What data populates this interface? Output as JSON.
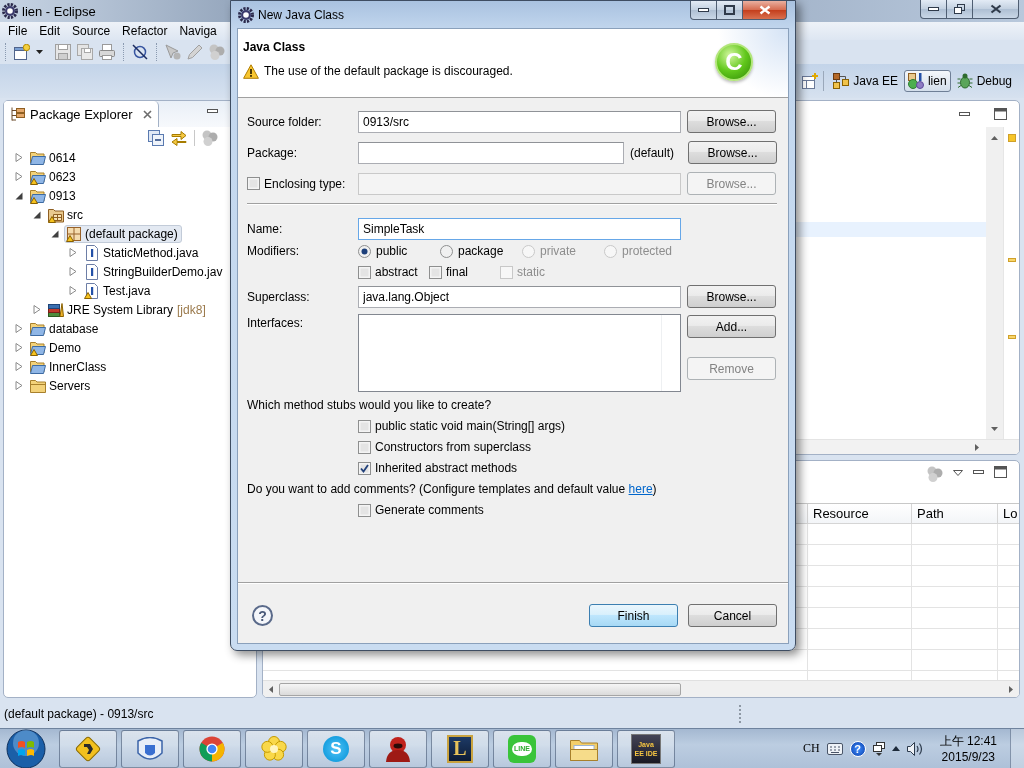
{
  "eclipse_window": {
    "title": "lien - Eclipse"
  },
  "menu_bar": [
    "File",
    "Edit",
    "Source",
    "Refactor",
    "Naviga"
  ],
  "perspectives": [
    {
      "label": "Java EE",
      "kind": "enterprise",
      "selected": false
    },
    {
      "label": "lien",
      "kind": "java",
      "selected": true
    },
    {
      "label": "Debug",
      "kind": "debug",
      "selected": false
    }
  ],
  "package_explorer": {
    "title": "Package Explorer",
    "tree": [
      {
        "label": "0614",
        "kind": "project",
        "warning": false,
        "expanded": false,
        "selected": false
      },
      {
        "label": "0623",
        "kind": "project",
        "warning": true,
        "expanded": false,
        "selected": false
      },
      {
        "label": "0913",
        "kind": "project",
        "warning": true,
        "expanded": true,
        "selected": false,
        "children": [
          {
            "label": "src",
            "kind": "source_folder",
            "warning": true,
            "expanded": true,
            "selected": false,
            "children": [
              {
                "label": "(default package)",
                "kind": "package",
                "warning": true,
                "expanded": true,
                "selected": true,
                "children": [
                  {
                    "label": "StaticMethod.java",
                    "kind": "java_file",
                    "warning": false,
                    "expanded": false,
                    "selected": false
                  },
                  {
                    "label": "StringBuilderDemo.jav",
                    "kind": "java_file",
                    "warning": false,
                    "expanded": false,
                    "selected": false
                  },
                  {
                    "label": "Test.java",
                    "kind": "java_file",
                    "warning": true,
                    "expanded": false,
                    "selected": false
                  }
                ]
              }
            ]
          },
          {
            "label": "JRE System Library",
            "decoration": "[jdk8]",
            "kind": "library",
            "warning": false,
            "expanded": false,
            "selected": false
          }
        ]
      },
      {
        "label": "database",
        "kind": "project",
        "warning": false,
        "expanded": false,
        "selected": false
      },
      {
        "label": "Demo",
        "kind": "project",
        "warning": true,
        "expanded": false,
        "selected": false
      },
      {
        "label": "InnerClass",
        "kind": "project",
        "warning": false,
        "expanded": false,
        "selected": false
      },
      {
        "label": "Servers",
        "kind": "folder",
        "warning": false,
        "expanded": false,
        "selected": false
      }
    ]
  },
  "problems_table": {
    "columns": [
      "Resource",
      "Path",
      "Lo"
    ]
  },
  "status_bar": {
    "text": "(default package) - 0913/src"
  },
  "dialog": {
    "title": "New Java Class",
    "header": {
      "title": "Java Class",
      "message": "The use of the default package is discouraged.",
      "icon_letter": "C"
    },
    "source_folder": {
      "label": "Source folder:",
      "value": "0913/src",
      "button": {
        "label": "Browse...",
        "disabled": false
      }
    },
    "package": {
      "label": "Package:",
      "suffix": "(default)",
      "button": {
        "label": "Browse...",
        "disabled": false
      }
    },
    "enclosing_type": {
      "label": "Enclosing type:",
      "checked": false,
      "disabled": true,
      "button": {
        "label": "Browse...",
        "disabled": true
      }
    },
    "name": {
      "label": "Name:",
      "value": "SimpleTask",
      "focused": true
    },
    "modifiers": {
      "label": "Modifiers:",
      "access": [
        {
          "label": "public",
          "selected": true,
          "disabled": false
        },
        {
          "label": "package",
          "selected": false,
          "disabled": false
        },
        {
          "label": "private",
          "selected": false,
          "disabled": true
        },
        {
          "label": "protected",
          "selected": false,
          "disabled": true
        }
      ],
      "flags": [
        {
          "label": "abstract",
          "checked": false,
          "disabled": false
        },
        {
          "label": "final",
          "checked": false,
          "disabled": false
        },
        {
          "label": "static",
          "checked": false,
          "disabled": true
        }
      ]
    },
    "superclass": {
      "label": "Superclass:",
      "value": "java.lang.Object",
      "button": {
        "label": "Browse...",
        "disabled": false
      }
    },
    "interfaces": {
      "label": "Interfaces:",
      "buttons": [
        {
          "label": "Add...",
          "disabled": false
        },
        {
          "label": "Remove",
          "disabled": true
        }
      ]
    },
    "stubs": {
      "question": "Which method stubs would you like to create?",
      "options": [
        {
          "label": "public static void main(String[] args)",
          "checked": false
        },
        {
          "label": "Constructors from superclass",
          "checked": false
        },
        {
          "label": "Inherited abstract methods",
          "checked": true
        }
      ]
    },
    "comments": {
      "text": "Do you want to add comments? (Configure templates and default value ",
      "link": "here",
      "text_end": ")",
      "options": [
        {
          "label": "Generate comments",
          "checked": false
        }
      ]
    },
    "help": "?",
    "buttons": [
      {
        "label": "Finish",
        "default": true
      },
      {
        "label": "Cancel",
        "default": false
      }
    ]
  },
  "taskbar": {
    "apps": [
      {
        "kind": "rhombus"
      },
      {
        "kind": "shield"
      },
      {
        "kind": "ring"
      },
      {
        "kind": "flower"
      },
      {
        "kind": "bubble",
        "text": "S"
      },
      {
        "kind": "figure"
      },
      {
        "kind": "emblem",
        "text": "L"
      },
      {
        "kind": "chat",
        "text": "LINE"
      },
      {
        "kind": "folder"
      },
      {
        "kind": "ide",
        "text": "Java EE IDE"
      }
    ],
    "language": "CH",
    "help": "?",
    "clock": {
      "time": "上午 12:41",
      "date": "2015/9/23"
    }
  }
}
